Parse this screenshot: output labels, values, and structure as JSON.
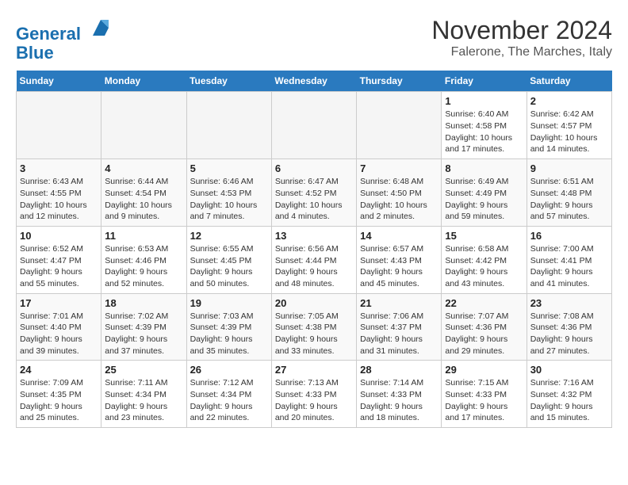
{
  "header": {
    "logo_line1": "General",
    "logo_line2": "Blue",
    "month": "November 2024",
    "location": "Falerone, The Marches, Italy"
  },
  "weekdays": [
    "Sunday",
    "Monday",
    "Tuesday",
    "Wednesday",
    "Thursday",
    "Friday",
    "Saturday"
  ],
  "weeks": [
    [
      {
        "day": "",
        "info": ""
      },
      {
        "day": "",
        "info": ""
      },
      {
        "day": "",
        "info": ""
      },
      {
        "day": "",
        "info": ""
      },
      {
        "day": "",
        "info": ""
      },
      {
        "day": "1",
        "info": "Sunrise: 6:40 AM\nSunset: 4:58 PM\nDaylight: 10 hours and 17 minutes."
      },
      {
        "day": "2",
        "info": "Sunrise: 6:42 AM\nSunset: 4:57 PM\nDaylight: 10 hours and 14 minutes."
      }
    ],
    [
      {
        "day": "3",
        "info": "Sunrise: 6:43 AM\nSunset: 4:55 PM\nDaylight: 10 hours and 12 minutes."
      },
      {
        "day": "4",
        "info": "Sunrise: 6:44 AM\nSunset: 4:54 PM\nDaylight: 10 hours and 9 minutes."
      },
      {
        "day": "5",
        "info": "Sunrise: 6:46 AM\nSunset: 4:53 PM\nDaylight: 10 hours and 7 minutes."
      },
      {
        "day": "6",
        "info": "Sunrise: 6:47 AM\nSunset: 4:52 PM\nDaylight: 10 hours and 4 minutes."
      },
      {
        "day": "7",
        "info": "Sunrise: 6:48 AM\nSunset: 4:50 PM\nDaylight: 10 hours and 2 minutes."
      },
      {
        "day": "8",
        "info": "Sunrise: 6:49 AM\nSunset: 4:49 PM\nDaylight: 9 hours and 59 minutes."
      },
      {
        "day": "9",
        "info": "Sunrise: 6:51 AM\nSunset: 4:48 PM\nDaylight: 9 hours and 57 minutes."
      }
    ],
    [
      {
        "day": "10",
        "info": "Sunrise: 6:52 AM\nSunset: 4:47 PM\nDaylight: 9 hours and 55 minutes."
      },
      {
        "day": "11",
        "info": "Sunrise: 6:53 AM\nSunset: 4:46 PM\nDaylight: 9 hours and 52 minutes."
      },
      {
        "day": "12",
        "info": "Sunrise: 6:55 AM\nSunset: 4:45 PM\nDaylight: 9 hours and 50 minutes."
      },
      {
        "day": "13",
        "info": "Sunrise: 6:56 AM\nSunset: 4:44 PM\nDaylight: 9 hours and 48 minutes."
      },
      {
        "day": "14",
        "info": "Sunrise: 6:57 AM\nSunset: 4:43 PM\nDaylight: 9 hours and 45 minutes."
      },
      {
        "day": "15",
        "info": "Sunrise: 6:58 AM\nSunset: 4:42 PM\nDaylight: 9 hours and 43 minutes."
      },
      {
        "day": "16",
        "info": "Sunrise: 7:00 AM\nSunset: 4:41 PM\nDaylight: 9 hours and 41 minutes."
      }
    ],
    [
      {
        "day": "17",
        "info": "Sunrise: 7:01 AM\nSunset: 4:40 PM\nDaylight: 9 hours and 39 minutes."
      },
      {
        "day": "18",
        "info": "Sunrise: 7:02 AM\nSunset: 4:39 PM\nDaylight: 9 hours and 37 minutes."
      },
      {
        "day": "19",
        "info": "Sunrise: 7:03 AM\nSunset: 4:39 PM\nDaylight: 9 hours and 35 minutes."
      },
      {
        "day": "20",
        "info": "Sunrise: 7:05 AM\nSunset: 4:38 PM\nDaylight: 9 hours and 33 minutes."
      },
      {
        "day": "21",
        "info": "Sunrise: 7:06 AM\nSunset: 4:37 PM\nDaylight: 9 hours and 31 minutes."
      },
      {
        "day": "22",
        "info": "Sunrise: 7:07 AM\nSunset: 4:36 PM\nDaylight: 9 hours and 29 minutes."
      },
      {
        "day": "23",
        "info": "Sunrise: 7:08 AM\nSunset: 4:36 PM\nDaylight: 9 hours and 27 minutes."
      }
    ],
    [
      {
        "day": "24",
        "info": "Sunrise: 7:09 AM\nSunset: 4:35 PM\nDaylight: 9 hours and 25 minutes."
      },
      {
        "day": "25",
        "info": "Sunrise: 7:11 AM\nSunset: 4:34 PM\nDaylight: 9 hours and 23 minutes."
      },
      {
        "day": "26",
        "info": "Sunrise: 7:12 AM\nSunset: 4:34 PM\nDaylight: 9 hours and 22 minutes."
      },
      {
        "day": "27",
        "info": "Sunrise: 7:13 AM\nSunset: 4:33 PM\nDaylight: 9 hours and 20 minutes."
      },
      {
        "day": "28",
        "info": "Sunrise: 7:14 AM\nSunset: 4:33 PM\nDaylight: 9 hours and 18 minutes."
      },
      {
        "day": "29",
        "info": "Sunrise: 7:15 AM\nSunset: 4:33 PM\nDaylight: 9 hours and 17 minutes."
      },
      {
        "day": "30",
        "info": "Sunrise: 7:16 AM\nSunset: 4:32 PM\nDaylight: 9 hours and 15 minutes."
      }
    ]
  ]
}
